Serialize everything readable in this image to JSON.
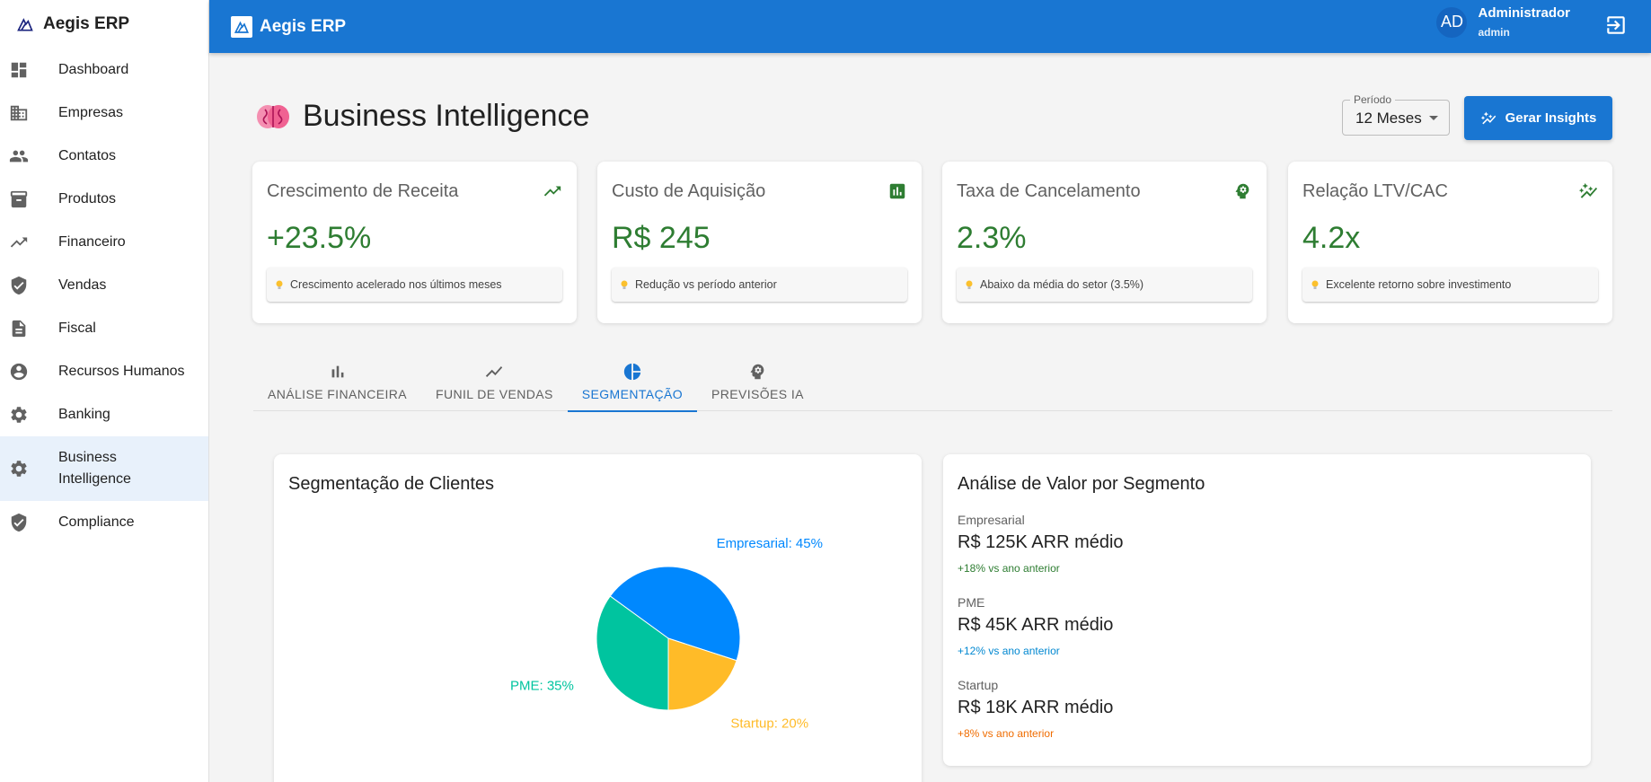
{
  "app": {
    "name": "Aegis ERP"
  },
  "sidebar": {
    "items": [
      {
        "label": "Dashboard",
        "icon": "dashboard-icon"
      },
      {
        "label": "Empresas",
        "icon": "building-icon"
      },
      {
        "label": "Contatos",
        "icon": "people-icon"
      },
      {
        "label": "Produtos",
        "icon": "archive-icon"
      },
      {
        "label": "Financeiro",
        "icon": "trending-up-icon"
      },
      {
        "label": "Vendas",
        "icon": "shield-icon"
      },
      {
        "label": "Fiscal",
        "icon": "document-icon"
      },
      {
        "label": "Recursos Humanos",
        "icon": "account-circle-icon"
      },
      {
        "label": "Banking",
        "icon": "gear-icon"
      },
      {
        "label": "Business Intelligence",
        "icon": "gear-icon",
        "active": true
      },
      {
        "label": "Compliance",
        "icon": "shield-icon"
      }
    ]
  },
  "topbar": {
    "title": "Aegis ERP",
    "user": {
      "initials": "AD",
      "name": "Administrador",
      "role": "admin"
    }
  },
  "page": {
    "title": "Business Intelligence",
    "period_label": "Período",
    "period_value": "12 Meses",
    "insights_button": "Gerar Insights"
  },
  "kpis": [
    {
      "title": "Crescimento de Receita",
      "value": "+23.5%",
      "note": "Crescimento acelerado nos últimos meses",
      "icon": "trending-up-icon"
    },
    {
      "title": "Custo de Aquisição",
      "value": "R$ 245",
      "note": "Redução vs período anterior",
      "icon": "bar-chart-icon"
    },
    {
      "title": "Taxa de Cancelamento",
      "value": "2.3%",
      "note": "Abaixo da média do setor (3.5%)",
      "icon": "psychology-icon"
    },
    {
      "title": "Relação LTV/CAC",
      "value": "4.2x",
      "note": "Excelente retorno sobre investimento",
      "icon": "auto-graph-icon"
    }
  ],
  "tabs": [
    {
      "label": "ANÁLISE FINANCEIRA",
      "icon": "bar-chart-icon"
    },
    {
      "label": "FUNIL DE VENDAS",
      "icon": "line-chart-icon"
    },
    {
      "label": "SEGMENTAÇÃO",
      "icon": "pie-chart-icon",
      "active": true
    },
    {
      "label": "PREVISÕES IA",
      "icon": "psychology-icon"
    }
  ],
  "segmentation": {
    "title": "Segmentação de Clientes"
  },
  "chart_data": {
    "type": "pie",
    "title": "Segmentação de Clientes",
    "slices": [
      {
        "label": "Empresarial: 45%",
        "name": "Empresarial",
        "value": 45,
        "color": "#0088fe"
      },
      {
        "label": "Startup: 20%",
        "name": "Startup",
        "value": 20,
        "color": "#ffbb28"
      },
      {
        "label": "PME: 35%",
        "name": "PME",
        "value": 35,
        "color": "#00c49f"
      }
    ]
  },
  "value_analysis": {
    "title": "Análise de Valor por Segmento",
    "segments": [
      {
        "name": "Empresarial",
        "value": "R$ 125K ARR médio",
        "change": "+18% vs ano anterior",
        "change_color": "#2e7d32"
      },
      {
        "name": "PME",
        "value": "R$ 45K ARR médio",
        "change": "+12% vs ano anterior",
        "change_color": "#0288d1"
      },
      {
        "name": "Startup",
        "value": "R$ 18K ARR médio",
        "change": "+8% vs ano anterior",
        "change_color": "#ef6c00"
      }
    ]
  }
}
